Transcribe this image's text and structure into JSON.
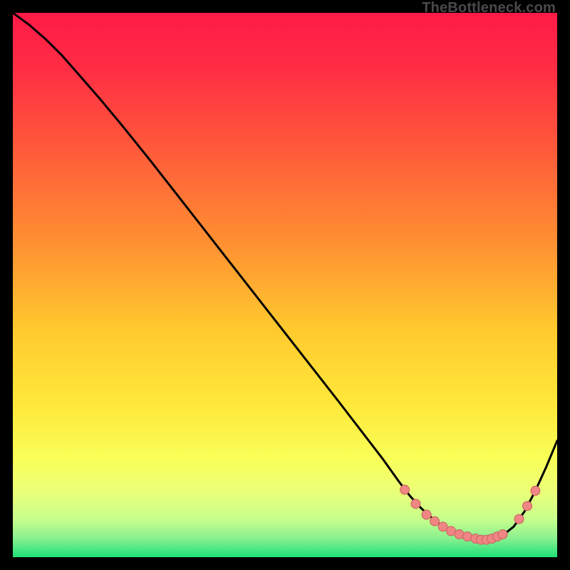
{
  "attribution": "TheBottleneck.com",
  "colors": {
    "black": "#000000",
    "curve": "#000000",
    "marker_fill": "#ef8683",
    "marker_stroke": "#c9605f",
    "grad_top": "#ff1a47",
    "grad_mid1": "#ff5a3a",
    "grad_mid2": "#ffb22e",
    "grad_mid3": "#ffe83a",
    "grad_mid4": "#f5ff6a",
    "grad_mid5": "#c8ff8c",
    "grad_bottom": "#1ee27a"
  },
  "chart_data": {
    "type": "line",
    "title": "",
    "xlabel": "",
    "ylabel": "",
    "xlim": [
      0,
      100
    ],
    "ylim": [
      0,
      100
    ],
    "grid": false,
    "legend": false,
    "note": "Axes are unlabeled in source; values estimated from pixel positions on a 0–100 normalized scale.",
    "series": [
      {
        "name": "curve",
        "x": [
          0,
          3,
          6,
          9,
          12,
          16,
          20,
          25,
          30,
          35,
          40,
          45,
          50,
          55,
          60,
          64,
          68,
          71,
          73,
          75,
          77,
          79,
          81,
          83,
          85,
          87,
          88.5,
          90,
          92,
          94,
          96,
          98,
          100
        ],
        "y": [
          100,
          97.8,
          95.2,
          92.2,
          88.8,
          84.2,
          79.4,
          73.2,
          66.8,
          60.4,
          54,
          47.6,
          41.2,
          34.8,
          28.4,
          23.2,
          18,
          13.8,
          11.2,
          9,
          7.2,
          5.6,
          4.4,
          3.6,
          3.2,
          3.2,
          3.4,
          4,
          5.6,
          8.4,
          12.2,
          16.6,
          21.4
        ]
      }
    ],
    "markers": {
      "name": "highlight-points",
      "x": [
        72,
        74,
        76,
        77.5,
        79,
        80.5,
        82,
        83.5,
        85,
        86,
        87,
        88,
        89,
        90,
        93,
        94.5,
        96
      ],
      "y": [
        12.4,
        9.8,
        7.8,
        6.6,
        5.6,
        4.8,
        4.2,
        3.8,
        3.4,
        3.2,
        3.2,
        3.4,
        3.8,
        4.2,
        7,
        9.4,
        12.2
      ]
    }
  }
}
